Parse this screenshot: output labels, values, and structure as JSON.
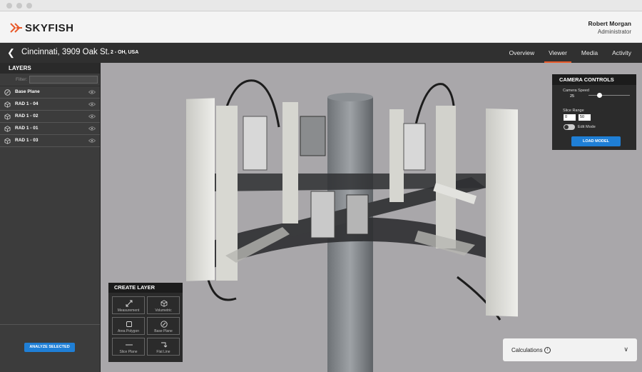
{
  "header": {
    "brand": "SKYFISH",
    "user_name": "Robert Morgan",
    "user_role": "Administrator"
  },
  "location": {
    "back_icon": "chevron-left-icon",
    "title": "Cincinnati, 3909 Oak St.",
    "subtitle": "2 - OH, USA"
  },
  "tabs": [
    {
      "label": "Overview",
      "active": false
    },
    {
      "label": "Viewer",
      "active": true
    },
    {
      "label": "Media",
      "active": false
    },
    {
      "label": "Activity",
      "active": false
    }
  ],
  "layers": {
    "heading": "LAYERS",
    "filter_label": "Filter:",
    "filter_value": "",
    "items": [
      {
        "label": "Base Plane",
        "icon": "compass-icon"
      },
      {
        "label": "RAD 1 - 04",
        "icon": "cube-icon"
      },
      {
        "label": "RAD 1 - 02",
        "icon": "cube-icon"
      },
      {
        "label": "RAD 1 - 01",
        "icon": "cube-icon"
      },
      {
        "label": "RAD 1 - 03",
        "icon": "cube-icon"
      }
    ],
    "analyze_button": "ANALYZE SELECTED"
  },
  "camera_controls": {
    "heading": "CAMERA CONTROLS",
    "speed_label": "Camera Speed",
    "speed_value": "25",
    "speed_fraction": 0.25,
    "slice_label": "Slice Range",
    "slice_min": "0",
    "slice_max": "50",
    "edit_mode_label": "Edit Mode",
    "edit_mode_on": true,
    "load_button": "LOAD MODEL"
  },
  "create_layer": {
    "heading": "CREATE LAYER",
    "tools": [
      {
        "label": "Measurement",
        "icon": "diagonal-arrows-icon"
      },
      {
        "label": "Volumetric",
        "icon": "cube-icon"
      },
      {
        "label": "Area Polygon",
        "icon": "square-icon"
      },
      {
        "label": "Base Plane",
        "icon": "compass-icon"
      },
      {
        "label": "Slice Plane",
        "icon": "horizontal-line-icon"
      },
      {
        "label": "Flat Line",
        "icon": "corner-arrow-icon"
      }
    ]
  },
  "calculations": {
    "label": "Calculations",
    "icon": "info-icon",
    "chevron": "chevron-down-icon"
  },
  "colors": {
    "accent_orange": "#e85a2a",
    "button_blue": "#1f7fd6",
    "viewport_bg": "#a9a7aa",
    "panel_dark": "#3c3c3c"
  }
}
